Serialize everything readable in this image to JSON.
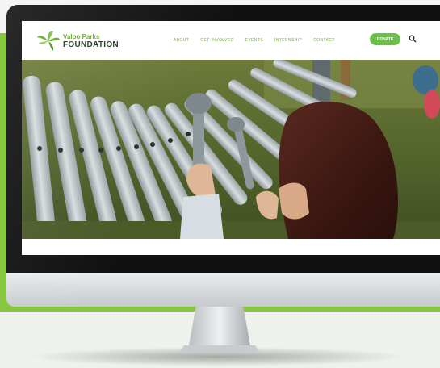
{
  "site": {
    "logo": {
      "line1": "Valpo Parks",
      "line2": "FOUNDATION"
    },
    "nav": [
      "ABOUT",
      "GET INVOLVED",
      "EVENTS",
      "INTERNSHIP",
      "CONTACT"
    ],
    "donate_label": "DONATE",
    "search_icon": "search-icon"
  },
  "colors": {
    "background_accent": "#86c641",
    "brand_green": "#6aac2c",
    "brand_dark": "#1b3a1e",
    "donate_button": "#6cc04a"
  },
  "hero": {
    "image": "child playing outdoor metal xylophone with mallets"
  }
}
